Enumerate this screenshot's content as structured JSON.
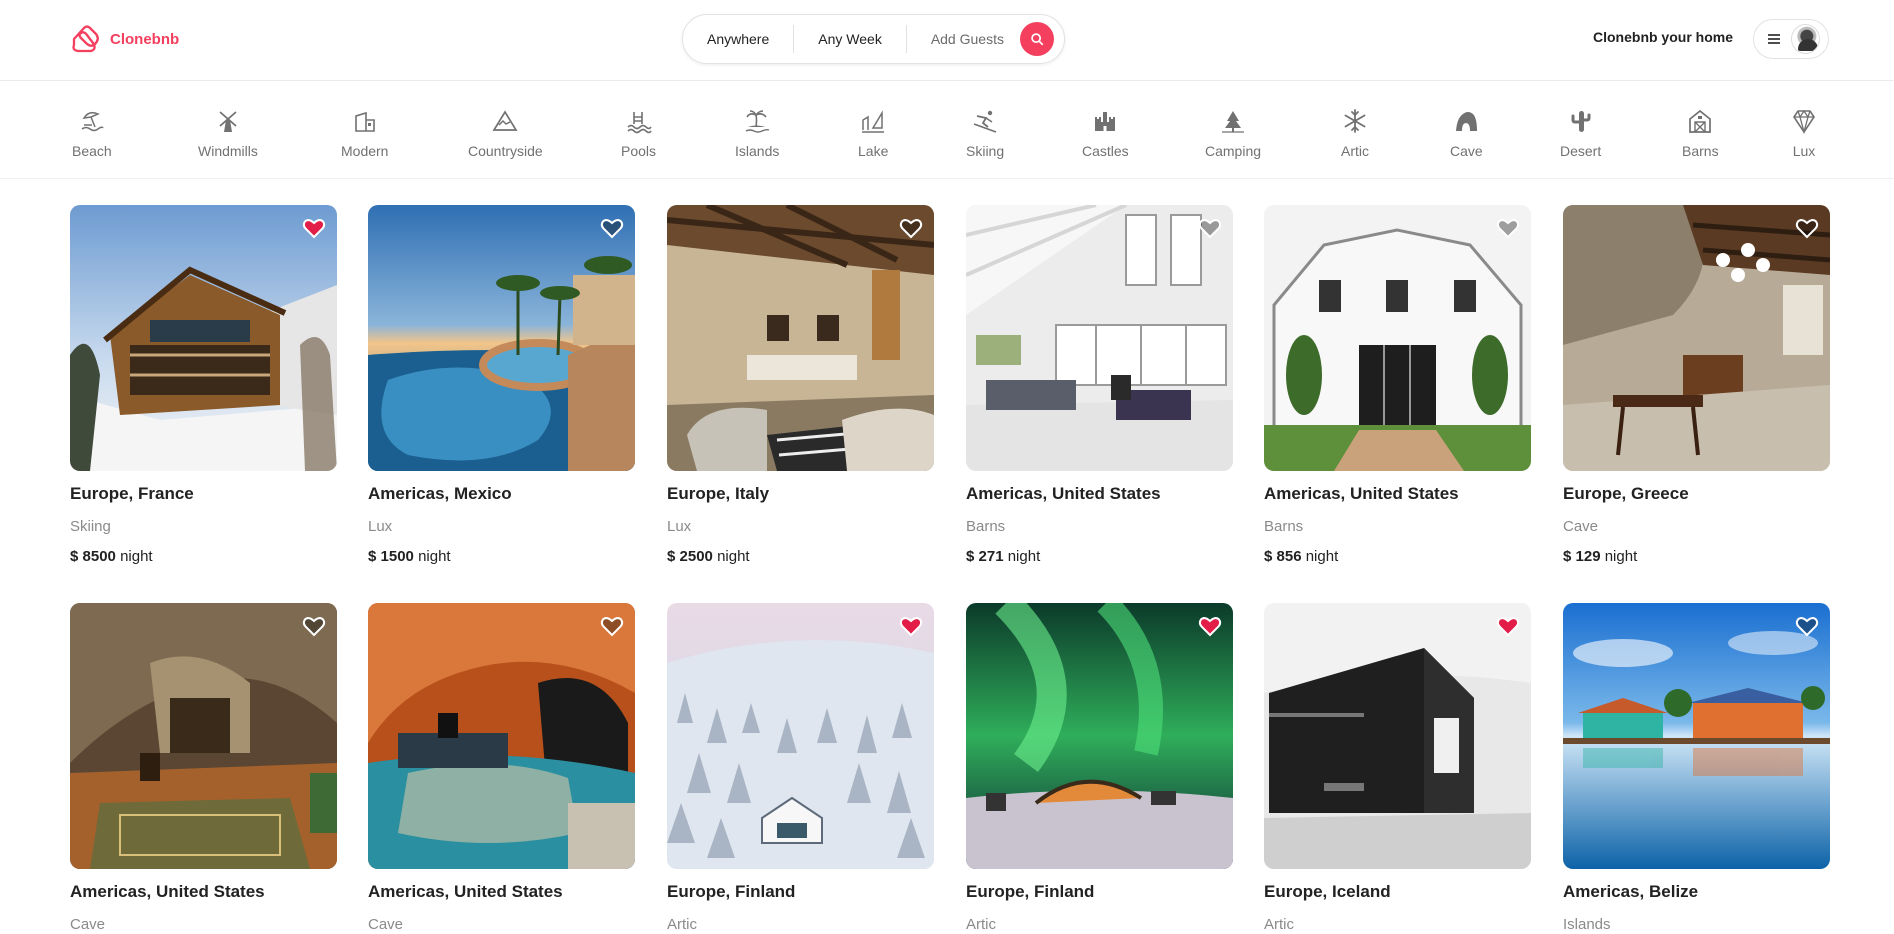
{
  "brand": {
    "name": "Clonebnb",
    "accent": "#f43f5e"
  },
  "search": {
    "where": "Anywhere",
    "when": "Any Week",
    "guests": "Add Guests"
  },
  "nav": {
    "host_label": "Clonebnb your home"
  },
  "categories": [
    {
      "label": "Beach",
      "icon": "beach-umbrella-icon"
    },
    {
      "label": "Windmills",
      "icon": "windmill-icon"
    },
    {
      "label": "Modern",
      "icon": "modern-house-icon"
    },
    {
      "label": "Countryside",
      "icon": "mountain-icon"
    },
    {
      "label": "Pools",
      "icon": "pool-icon"
    },
    {
      "label": "Islands",
      "icon": "island-icon"
    },
    {
      "label": "Lake",
      "icon": "lake-icon"
    },
    {
      "label": "Skiing",
      "icon": "skier-icon"
    },
    {
      "label": "Castles",
      "icon": "castle-icon"
    },
    {
      "label": "Camping",
      "icon": "tent-icon"
    },
    {
      "label": "Artic",
      "icon": "snowflake-icon"
    },
    {
      "label": "Cave",
      "icon": "cave-icon"
    },
    {
      "label": "Desert",
      "icon": "cactus-icon"
    },
    {
      "label": "Barns",
      "icon": "barn-icon"
    },
    {
      "label": "Lux",
      "icon": "diamond-icon"
    }
  ],
  "listings": [
    {
      "location": "Europe, France",
      "category": "Skiing",
      "price": "$ 8500",
      "unit": "night",
      "favorite": true
    },
    {
      "location": "Americas, Mexico",
      "category": "Lux",
      "price": "$ 1500",
      "unit": "night",
      "favorite": false
    },
    {
      "location": "Europe, Italy",
      "category": "Lux",
      "price": "$ 2500",
      "unit": "night",
      "favorite": false
    },
    {
      "location": "Americas, United States",
      "category": "Barns",
      "price": "$ 271",
      "unit": "night",
      "favorite": false
    },
    {
      "location": "Americas, United States",
      "category": "Barns",
      "price": "$ 856",
      "unit": "night",
      "favorite": false
    },
    {
      "location": "Europe, Greece",
      "category": "Cave",
      "price": "$ 129",
      "unit": "night",
      "favorite": false
    },
    {
      "location": "Americas, United States",
      "category": "Cave",
      "favorite": false
    },
    {
      "location": "Americas, United States",
      "category": "Cave",
      "favorite": false
    },
    {
      "location": "Europe, Finland",
      "category": "Artic",
      "favorite": true
    },
    {
      "location": "Europe, Finland",
      "category": "Artic",
      "favorite": true
    },
    {
      "location": "Europe, Iceland",
      "category": "Artic",
      "favorite": true
    },
    {
      "location": "Americas, Belize",
      "category": "Islands",
      "favorite": false
    }
  ]
}
